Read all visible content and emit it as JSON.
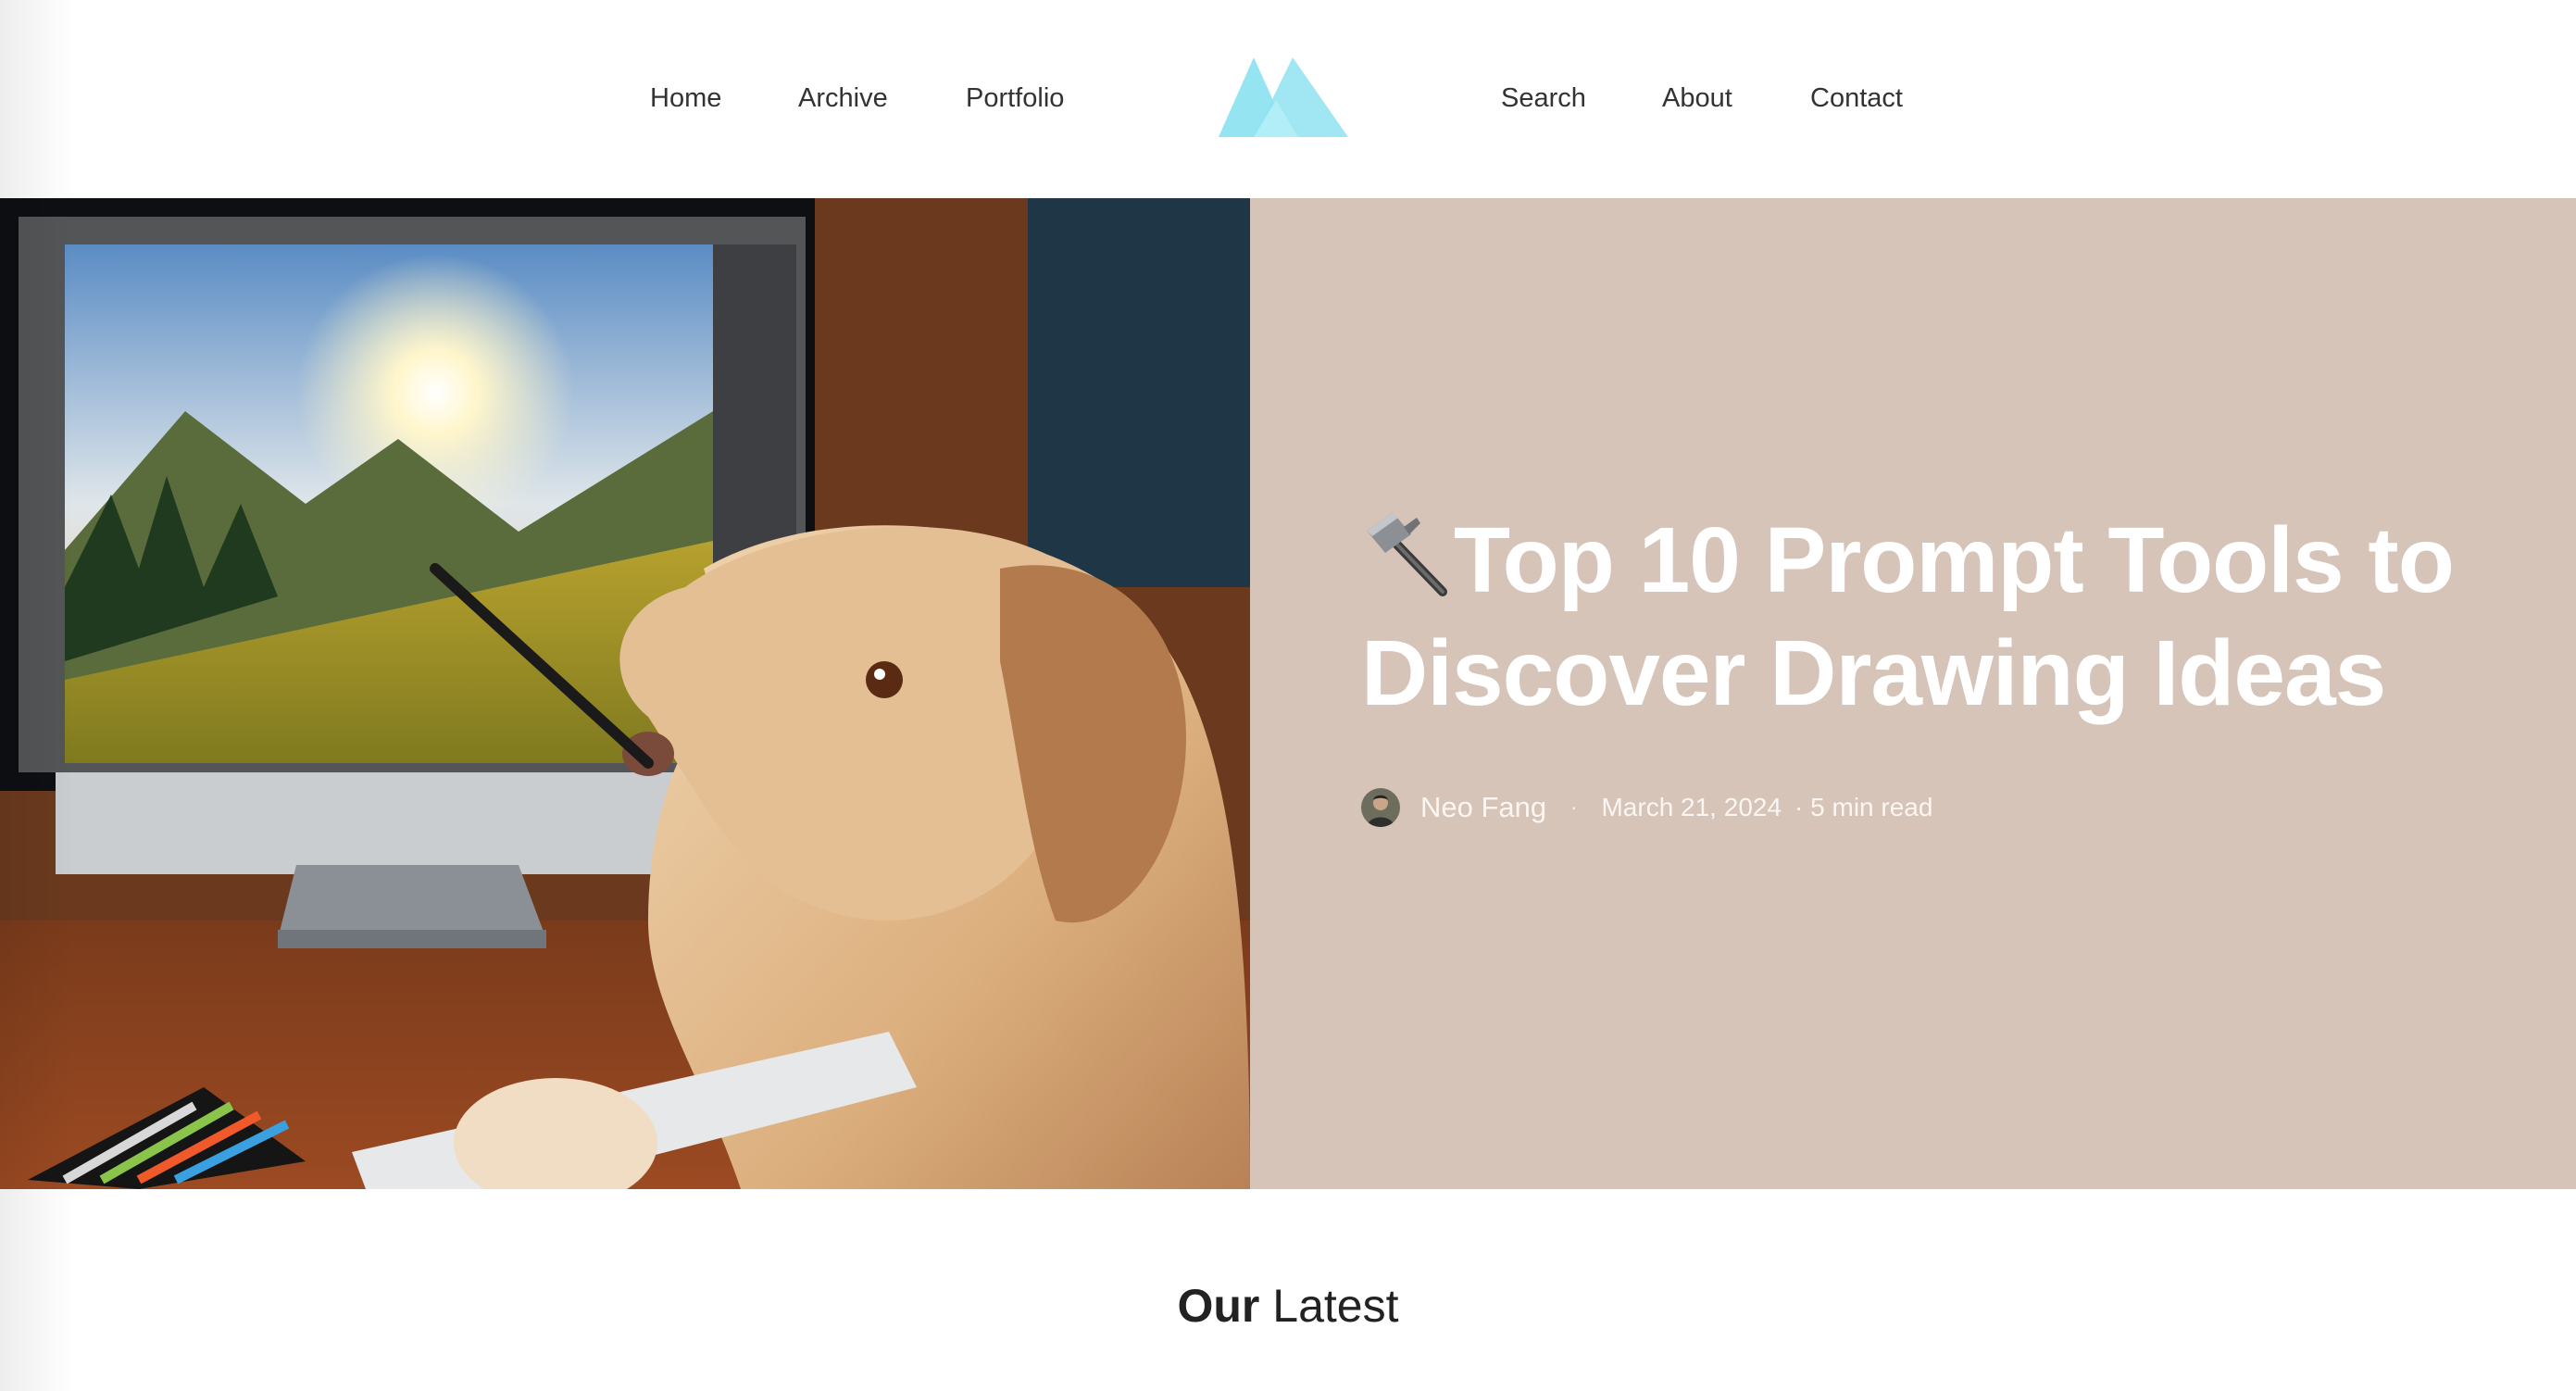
{
  "nav": {
    "left": [
      "Home",
      "Archive",
      "Portfolio"
    ],
    "right": [
      "Search",
      "About",
      "Contact"
    ]
  },
  "logo": {
    "icon": "mountain-logo",
    "color": "#8FE3F1"
  },
  "hero": {
    "image_alt": "Dog drawing a landscape on a computer",
    "panel_color": "#D6C4B9",
    "title_emoji": "hammer",
    "title": "Top 10 Prompt Tools to Discover Drawing Ideas",
    "author": "Neo Fang",
    "date": "March 21, 2024",
    "read_time": "· 5 min read",
    "separator": "·"
  },
  "latest": {
    "bold": "Our",
    "regular": "Latest"
  }
}
